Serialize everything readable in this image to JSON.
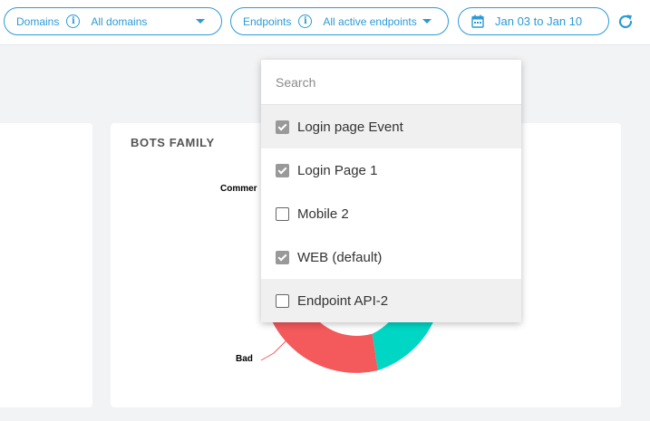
{
  "filters": {
    "domains": {
      "label": "Domains",
      "value": "All domains"
    },
    "endpoints": {
      "label": "Endpoints",
      "value": "All active endpoints"
    },
    "date": {
      "value": "Jan 03 to Jan 10"
    }
  },
  "colors": {
    "accent": "#2b9ad7",
    "bad": "#f4595b",
    "good": "#00d6c4"
  },
  "cards": {
    "bots_family": {
      "title": "BOTS FAMILY",
      "labels": {
        "commercial": "Commer",
        "bad": "Bad"
      }
    }
  },
  "dropdown": {
    "search_placeholder": "Search",
    "options": [
      {
        "label": "Login page Event",
        "checked": true
      },
      {
        "label": "Login Page 1",
        "checked": true
      },
      {
        "label": "Mobile 2",
        "checked": false
      },
      {
        "label": "WEB (default)",
        "checked": true
      },
      {
        "label": "Endpoint API-2",
        "checked": false
      }
    ]
  }
}
